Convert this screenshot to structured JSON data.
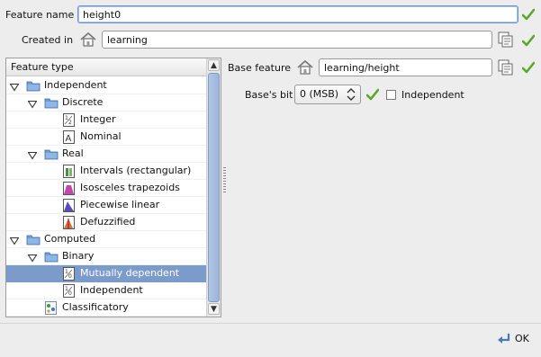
{
  "feature_name": {
    "label": "Feature name",
    "value": "height0"
  },
  "created_in": {
    "label": "Created in",
    "value": "learning"
  },
  "tree": {
    "header": "Feature type",
    "rows": [
      {
        "label": "Independent",
        "level": 0,
        "kind": "folder",
        "expanded": true
      },
      {
        "label": "Discrete",
        "level": 1,
        "kind": "folder",
        "expanded": true
      },
      {
        "label": "Integer",
        "level": 2,
        "kind": "integer"
      },
      {
        "label": "Nominal",
        "level": 2,
        "kind": "nominal"
      },
      {
        "label": "Real",
        "level": 1,
        "kind": "folder",
        "expanded": true
      },
      {
        "label": "Intervals (rectangular)",
        "level": 2,
        "kind": "intervals"
      },
      {
        "label": "Isosceles trapezoids",
        "level": 2,
        "kind": "trapezoid"
      },
      {
        "label": "Piecewise linear",
        "level": 2,
        "kind": "piecewise"
      },
      {
        "label": "Defuzzified",
        "level": 2,
        "kind": "defuzzified"
      },
      {
        "label": "Computed",
        "level": 0,
        "kind": "folder",
        "expanded": true
      },
      {
        "label": "Binary",
        "level": 1,
        "kind": "folder",
        "expanded": true
      },
      {
        "label": "Mutually dependent",
        "level": 2,
        "kind": "binary",
        "selected": true
      },
      {
        "label": "Independent",
        "level": 2,
        "kind": "binary"
      },
      {
        "label": "Classificatory",
        "level": 1,
        "kind": "classificatory"
      }
    ]
  },
  "base_feature": {
    "label": "Base feature",
    "value": "learning/height"
  },
  "bases_bit": {
    "label": "Base's bit",
    "value": "0 (MSB)"
  },
  "independent_checkbox": {
    "label": "Independent",
    "checked": false
  },
  "ok_button": {
    "label": "OK"
  },
  "colors": {
    "check_green": "#5aa82a",
    "selection": "#7b9bcb",
    "folder_blue": "#6f9fd8"
  }
}
